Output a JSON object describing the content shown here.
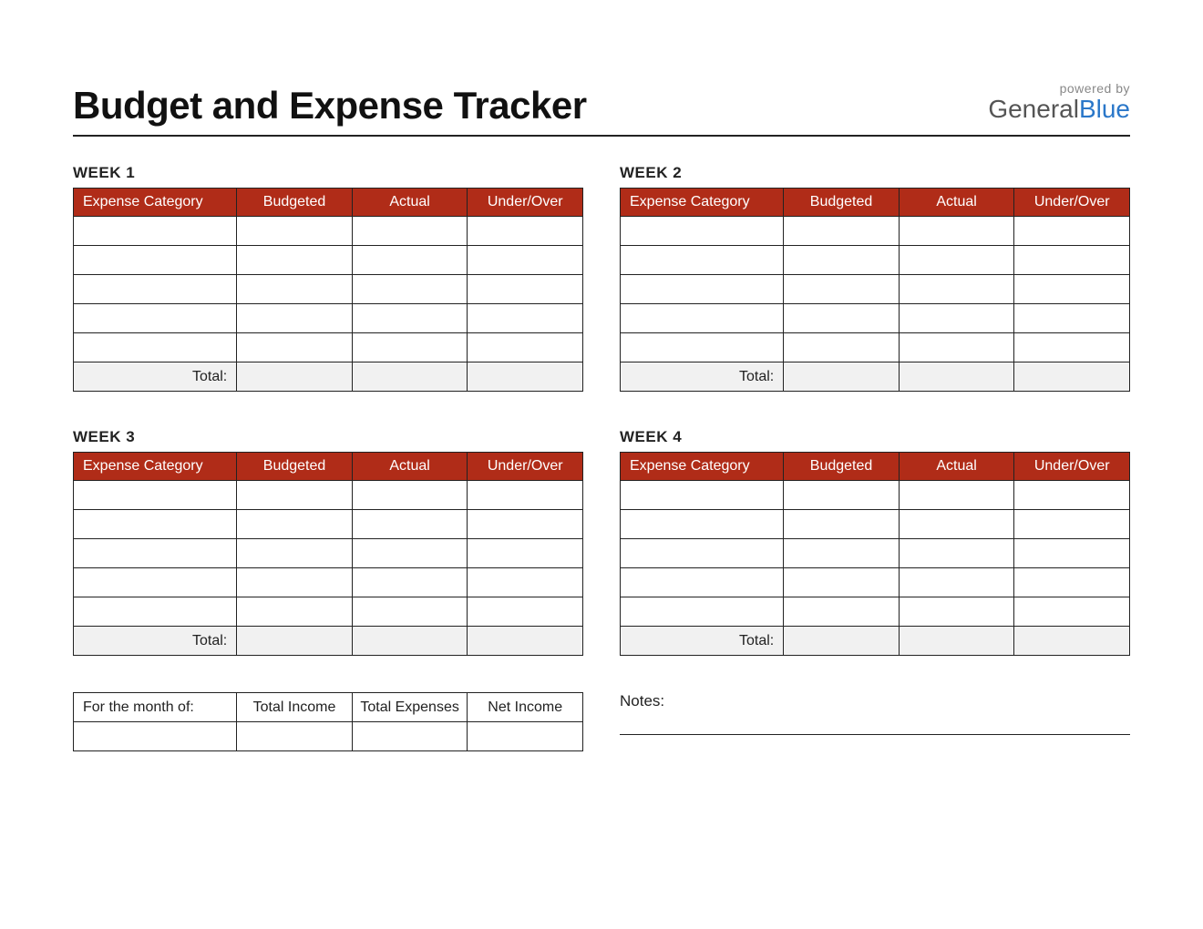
{
  "title": "Budget and Expense Tracker",
  "brand": {
    "powered_by": "powered by",
    "general": "General",
    "blue": "Blue"
  },
  "columns": {
    "category": "Expense Category",
    "budgeted": "Budgeted",
    "actual": "Actual",
    "under_over": "Under/Over"
  },
  "total_label": "Total:",
  "weeks": [
    {
      "label": "WEEK 1",
      "rows": [
        {
          "category": "",
          "budgeted": "",
          "actual": "",
          "under_over": ""
        },
        {
          "category": "",
          "budgeted": "",
          "actual": "",
          "under_over": ""
        },
        {
          "category": "",
          "budgeted": "",
          "actual": "",
          "under_over": ""
        },
        {
          "category": "",
          "budgeted": "",
          "actual": "",
          "under_over": ""
        },
        {
          "category": "",
          "budgeted": "",
          "actual": "",
          "under_over": ""
        }
      ],
      "total": {
        "budgeted": "",
        "actual": "",
        "under_over": ""
      }
    },
    {
      "label": "WEEK 2",
      "rows": [
        {
          "category": "",
          "budgeted": "",
          "actual": "",
          "under_over": ""
        },
        {
          "category": "",
          "budgeted": "",
          "actual": "",
          "under_over": ""
        },
        {
          "category": "",
          "budgeted": "",
          "actual": "",
          "under_over": ""
        },
        {
          "category": "",
          "budgeted": "",
          "actual": "",
          "under_over": ""
        },
        {
          "category": "",
          "budgeted": "",
          "actual": "",
          "under_over": ""
        }
      ],
      "total": {
        "budgeted": "",
        "actual": "",
        "under_over": ""
      }
    },
    {
      "label": "WEEK 3",
      "rows": [
        {
          "category": "",
          "budgeted": "",
          "actual": "",
          "under_over": ""
        },
        {
          "category": "",
          "budgeted": "",
          "actual": "",
          "under_over": ""
        },
        {
          "category": "",
          "budgeted": "",
          "actual": "",
          "under_over": ""
        },
        {
          "category": "",
          "budgeted": "",
          "actual": "",
          "under_over": ""
        },
        {
          "category": "",
          "budgeted": "",
          "actual": "",
          "under_over": ""
        }
      ],
      "total": {
        "budgeted": "",
        "actual": "",
        "under_over": ""
      }
    },
    {
      "label": "WEEK 4",
      "rows": [
        {
          "category": "",
          "budgeted": "",
          "actual": "",
          "under_over": ""
        },
        {
          "category": "",
          "budgeted": "",
          "actual": "",
          "under_over": ""
        },
        {
          "category": "",
          "budgeted": "",
          "actual": "",
          "under_over": ""
        },
        {
          "category": "",
          "budgeted": "",
          "actual": "",
          "under_over": ""
        },
        {
          "category": "",
          "budgeted": "",
          "actual": "",
          "under_over": ""
        }
      ],
      "total": {
        "budgeted": "",
        "actual": "",
        "under_over": ""
      }
    }
  ],
  "summary": {
    "month_label": "For the month of:",
    "income_label": "Total Income",
    "expenses_label": "Total Expenses",
    "net_label": "Net Income",
    "month_value": "",
    "income_value": "",
    "expenses_value": "",
    "net_value": ""
  },
  "notes_label": "Notes:"
}
